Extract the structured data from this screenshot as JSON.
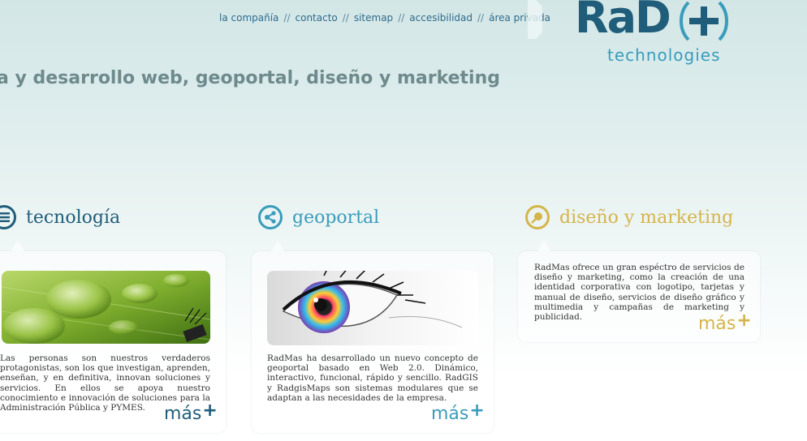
{
  "nav": {
    "items": [
      "la compañía",
      "contacto",
      "sitemap",
      "accesibilidad",
      "área privada"
    ],
    "separator": "//"
  },
  "logo": {
    "main": "RaD",
    "sub": "technologies"
  },
  "tagline": "a y desarrollo web, geoportal, diseño y marketing",
  "colors": {
    "dark_blue": "#1f5d7a",
    "teal": "#3a9cbb",
    "gold": "#d4b54a",
    "gray_text": "#6e8a8c"
  },
  "columns": [
    {
      "title": "tecnología",
      "icon": "list-icon",
      "text": "Las personas son nuestros verdaderos protagonistas, son los que investigan, aprenden, enseñan, y en definitiva, innovan soluciones y servicios. En ellos se apoya nuestro conocimiento e innovación de soluciones para la Administración Pública y PYMES.",
      "more": "más"
    },
    {
      "title": "geoportal",
      "icon": "share-icon",
      "text": "RadMas ha desarrollado un nuevo concepto de geoportal basado en Web 2.0. Dinámico, interactivo, funcional, rápido y sencillo. RadGIS y RadgisMaps son sistemas modulares que se adaptan a las necesidades de la empresa.",
      "more": "más"
    },
    {
      "title": "diseño y marketing",
      "icon": "brush-icon",
      "text": "RadMas ofrece un gran espéctro de servicios de diseño y marketing, como la creación de una identidad corporativa con logotipo, tarjetas y manual de diseño, servicios de diseño gráfico y multimedia y campañas de marketing y publicidad.",
      "more": "más"
    }
  ]
}
